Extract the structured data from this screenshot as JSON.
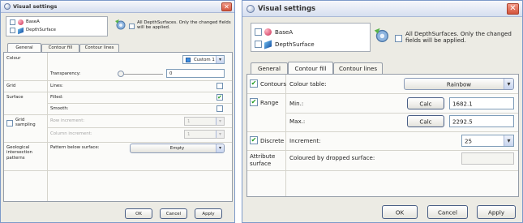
{
  "left_dialog": {
    "title": "Visual settings",
    "close_glyph": "✕",
    "objects": [
      {
        "name": "BaseA",
        "checked": false,
        "icon": "basea-icon"
      },
      {
        "name": "DepthSurface",
        "checked": false,
        "icon": "depth-surface-icon"
      }
    ],
    "apply_all_text": "All DepthSurfaces. Only the changed fields will be applied.",
    "tabs": [
      "General",
      "Contour fill",
      "Contour lines"
    ],
    "active_tab": "General",
    "rows": {
      "colour_label": "Colour",
      "colour_value": "Custom 1",
      "colour_swatch": "#3a8ee6",
      "transparency_label": "Transparency:",
      "transparency_value": "0",
      "grid_label": "Grid",
      "lines_label": "Lines:",
      "surface_label": "Surface",
      "filled_label": "Filled:",
      "smooth_label": "Smooth:",
      "grid_sampling_label": "Grid sampling",
      "row_increment_label": "Row increment:",
      "row_increment_value": "1",
      "column_increment_label": "Column increment:",
      "column_increment_value": "1",
      "geological_label": "Geological intersection patterns",
      "pattern_label": "Pattern below surface:",
      "pattern_value": "Empty"
    },
    "buttons": {
      "ok": "OK",
      "cancel": "Cancel",
      "apply": "Apply"
    }
  },
  "right_dialog": {
    "title": "Visual settings",
    "close_glyph": "✕",
    "objects": [
      {
        "name": "BaseA",
        "checked": false,
        "icon": "basea-icon"
      },
      {
        "name": "DepthSurface",
        "checked": false,
        "icon": "depth-surface-icon"
      }
    ],
    "apply_all_text": "All DepthSurfaces. Only the changed fields will be applied.",
    "tabs": [
      "General",
      "Contour fill",
      "Contour lines"
    ],
    "active_tab": "Contour fill",
    "rows": {
      "contours_label": "Contours",
      "colour_table_label": "Colour table:",
      "colour_table_value": "Rainbow",
      "range_label": "Range",
      "min_label": "Min.:",
      "min_value": "1682.1",
      "max_label": "Max.:",
      "max_value": "2292.5",
      "calc_label": "Calc",
      "discrete_label": "Discrete",
      "increment_label": "Increment:",
      "increment_value": "25",
      "attribute_label": "Attribute surface",
      "coloured_label": "Coloured by dropped surface:",
      "coloured_value": ""
    },
    "buttons": {
      "ok": "OK",
      "cancel": "Cancel",
      "apply": "Apply"
    }
  },
  "colors": {
    "accent": "#3a8ee6",
    "check": "#1e9a1e",
    "close": "#d3533c",
    "dialog_bg": "#ecebe4",
    "panel_bg": "#fbfbf9"
  }
}
